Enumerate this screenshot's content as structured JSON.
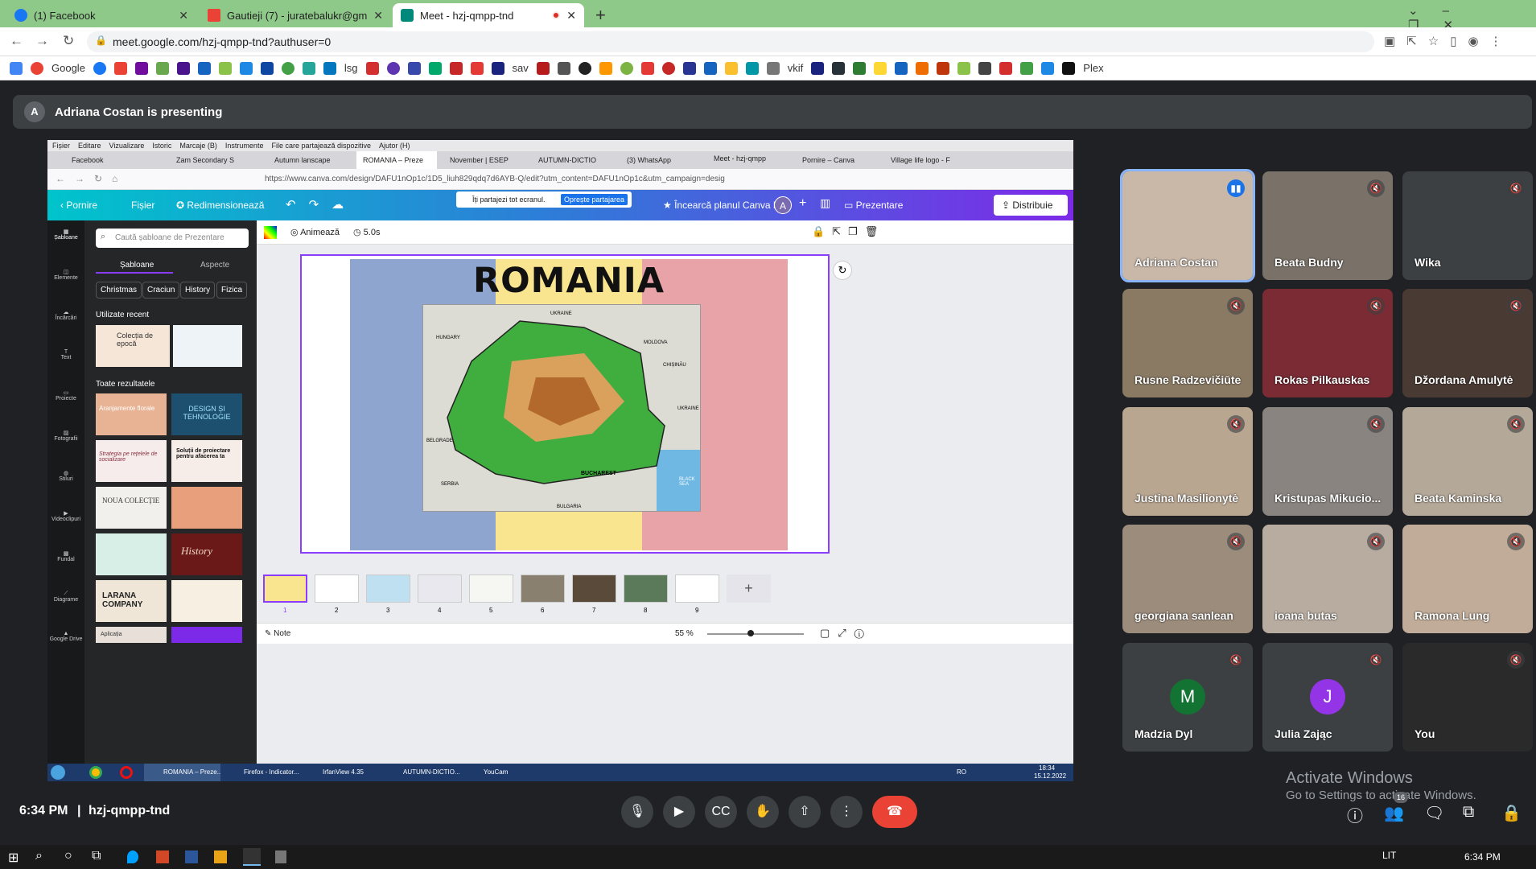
{
  "browser": {
    "tabs": [
      {
        "label": "(1) Facebook",
        "color": "#1877f2",
        "active": false
      },
      {
        "label": "Gautieji (7) - juratebalukr@gmail",
        "color": "#ea4335",
        "active": false
      },
      {
        "label": "Meet - hzj-qmpp-tnd",
        "color": "#00897b",
        "active": true
      }
    ],
    "url": "meet.google.com/hzj-qmpp-tnd?authuser=0",
    "bookmarks": [
      "Google",
      "lsg",
      "sav",
      "vkif",
      "Plex"
    ]
  },
  "meet": {
    "presenter_initial": "A",
    "presenting_text": "Adriana Costan is presenting",
    "time": "6:34 PM",
    "code": "hzj-qmpp-tnd",
    "participants": [
      {
        "name": "Adriana Costan",
        "bg": "#c9b8a8",
        "speaking": true
      },
      {
        "name": "Beata Budny",
        "bg": "#7a7268"
      },
      {
        "name": "Wika",
        "bg": "#3c4043"
      },
      {
        "name": "Rusne Radzevičiūte",
        "bg": "#8a7a64"
      },
      {
        "name": "Rokas Pilkauskas",
        "bg": "#7a2b34"
      },
      {
        "name": "Džordana Amulytė",
        "bg": "#4a3a34"
      },
      {
        "name": "Justina Masilionytė",
        "bg": "#b9a691"
      },
      {
        "name": "Kristupas Mikucio...",
        "bg": "#8a8480"
      },
      {
        "name": "Beata Kaminska",
        "bg": "#b4a898"
      },
      {
        "name": "georgiana sanlean",
        "bg": "#9c8c7c"
      },
      {
        "name": "ioana butas",
        "bg": "#b8aca0"
      },
      {
        "name": "Ramona Lung",
        "bg": "#c0ac98"
      },
      {
        "name": "Madzia Dyl",
        "bg": "#3c4043",
        "initial": "M",
        "avatar": "#137333"
      },
      {
        "name": "Julia Zając",
        "bg": "#3c4043",
        "initial": "J",
        "avatar": "#9334e6"
      },
      {
        "name": "You",
        "bg": "#2a2a2a"
      }
    ],
    "activate_title": "Activate Windows",
    "activate_sub": "Go to Settings to activate Windows.",
    "people_count": "16"
  },
  "canva": {
    "menu": [
      "Fișier",
      "Editare",
      "Vizualizare",
      "Istoric",
      "Marcaje (B)",
      "Instrumente",
      "File care partajează dispozitive",
      "Ajutor (H)"
    ],
    "tabs": [
      "Facebook",
      "Zam Secondary S",
      "Autumn lanscape",
      "ROMANIA – Preze",
      "November | ESEP",
      "AUTUMN-DICTIO",
      "(3) WhatsApp",
      "Meet - hzj-qmpp",
      "Pornire – Canva",
      "Village life logo - F"
    ],
    "url": "https://www.canva.com/design/DAFU1nOp1c/1D5_liuh829qdq7d6AYB-Q/edit?utm_content=DAFU1nOp1c&utm_campaign=desig",
    "home": "Pornire",
    "file": "Fișier",
    "resize": "Redimensionează",
    "sharing": "Îți partajezi tot ecranul.",
    "stop": "Oprește partajarea",
    "pro": "Încearcă planul Canva Pro",
    "avatar": "A",
    "present": "Prezentare",
    "share": "Distribuie",
    "search": "Caută șabloane de Prezentare",
    "tab1": "Șabloane",
    "tab2": "Aspecte",
    "chips": [
      "Christmas",
      "Craciun",
      "History",
      "Fizica"
    ],
    "recent": "Utilizate recent",
    "all": "Toate rezultatele",
    "side": [
      "Șabloane",
      "Elemente",
      "Încărcări",
      "Text",
      "Proiecte",
      "Fotografii",
      "Stiluri",
      "Videoclipuri",
      "Fundal",
      "Diagrame",
      "Google Drive"
    ],
    "animate": "Animează",
    "duration": "5.0s",
    "slide_title": "ROMANIA",
    "map_labels": [
      "UKRAINE",
      "HUNGARY",
      "MOLDOVA",
      "UKRAINE",
      "BUCHAREST",
      "SERBIA",
      "BULGARIA",
      "BLACK SEA",
      "CHIȘINĂU",
      "BELGRADE"
    ],
    "pages": [
      "1",
      "2",
      "3",
      "4",
      "5",
      "6",
      "7",
      "8",
      "9"
    ],
    "note": "Note",
    "zoom": "55 %",
    "templates": [
      "Colecția de epocă",
      "DESIGN ȘI TEHNOLOGIE",
      "Aranjamente florale",
      "Strategia pe rețelele de socializare",
      "Soluții de proiectare pentru afacerea ta",
      "NOUA COLECȚIE",
      "History",
      "LARANA COMPANY",
      "Aplicația"
    ]
  },
  "inner_taskbar": [
    "ROMANIA – Preze...",
    "Firefox - Indicator...",
    "IrfanView 4.35",
    "AUTUMN-DICTIO...",
    "YouCam"
  ],
  "inner_clock": {
    "lang": "RO",
    "time": "18:34",
    "date": "15.12.2022"
  },
  "taskbar": {
    "lang": "LIT",
    "time": "6:34 PM"
  }
}
